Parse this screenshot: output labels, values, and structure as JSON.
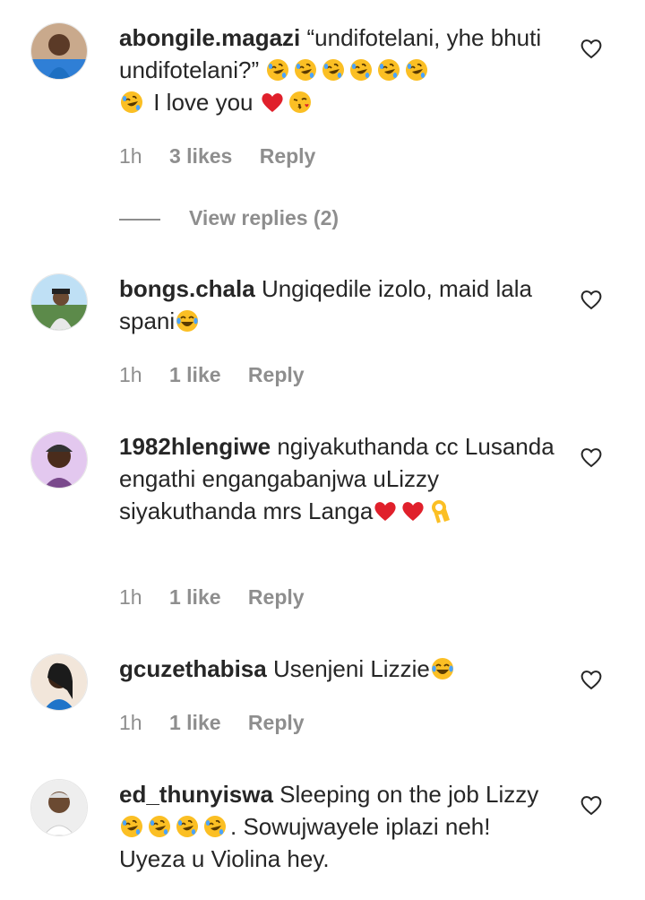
{
  "comments": [
    {
      "username": "abongile.magazi",
      "text_parts": [
        "“undifotelani, yhe bhuti undifotelani?” ",
        "",
        "",
        "",
        "",
        "",
        "",
        " I love you ",
        "",
        ""
      ],
      "emojis": [
        "rofl-emoji",
        "rofl-emoji",
        "rofl-emoji",
        "rofl-emoji",
        "rofl-emoji",
        "rofl-emoji",
        "rofl-emoji",
        "red-heart-emoji",
        "kiss-face-emoji"
      ],
      "time": "1h",
      "likes": "3 likes",
      "reply": "Reply",
      "view_replies": "View replies (2)"
    },
    {
      "username": "bongs.chala",
      "text": "Ungiqedile izolo, maid lala spani",
      "emojis": [
        "joy-emoji"
      ],
      "time": "1h",
      "likes": "1 like",
      "reply": "Reply"
    },
    {
      "username": "1982hlengiwe",
      "text": "ngiyakuthanda cc Lusanda engathi engangabanjwa uLizzy siyakuthanda mrs Langa",
      "emojis": [
        "red-heart-emoji",
        "red-heart-emoji",
        "ok-hand-emoji"
      ],
      "time": "1h",
      "likes": "1 like",
      "reply": "Reply"
    },
    {
      "username": "gcuzethabisa",
      "text": "Usenjeni Lizzie",
      "emojis": [
        "joy-emoji"
      ],
      "time": "1h",
      "likes": "1 like",
      "reply": "Reply"
    },
    {
      "username": "ed_thunyiswa",
      "text_a": "Sleeping on the job Lizzy ",
      "text_b": ". Sowujwayele iplazi neh! Uyeza u Violina hey.",
      "emojis": [
        "rofl-emoji",
        "rofl-emoji",
        "rofl-emoji",
        "rofl-emoji"
      ]
    }
  ],
  "colors": {
    "text": "#262626",
    "secondary": "#8e8e8e",
    "heart_red": "#e0202b",
    "emoji_yellow": "#fbbf24"
  }
}
